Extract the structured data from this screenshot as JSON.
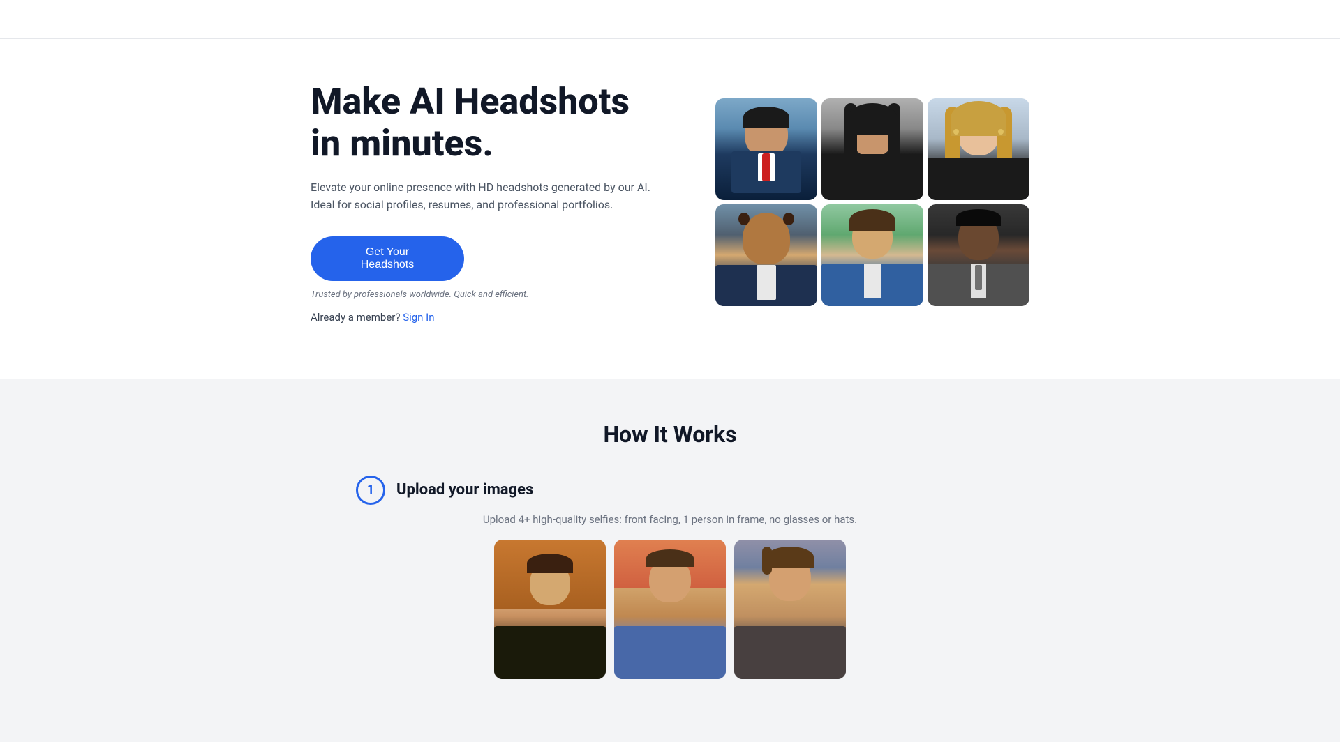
{
  "nav": {
    "brand": ""
  },
  "hero": {
    "title": "Make AI Headshots in minutes.",
    "subtitle": "Elevate your online presence with HD headshots generated by our AI. Ideal for social profiles, resumes, and professional portfolios.",
    "cta_button_label": "Get Your Headshots",
    "trusted_text": "Trusted by professionals worldwide. Quick and efficient.",
    "signin_prefix": "Already a member?",
    "signin_link": "Sign In"
  },
  "how_it_works": {
    "section_title": "How It Works",
    "step1": {
      "number": "1",
      "title": "Upload your images",
      "description": "Upload 4+ high-quality selfies: front facing, 1 person in frame, no glasses or hats."
    }
  },
  "photos": {
    "grid": [
      {
        "id": "person-1",
        "alt": "Man in blue suit with red tie"
      },
      {
        "id": "person-2",
        "alt": "Woman with dark hair in black top"
      },
      {
        "id": "person-3",
        "alt": "Woman with blonde hair"
      },
      {
        "id": "person-4",
        "alt": "Bald man in suit"
      },
      {
        "id": "person-5",
        "alt": "Young man in blue jacket"
      },
      {
        "id": "person-6",
        "alt": "Black man in grey suit"
      }
    ],
    "selfies": [
      {
        "id": "selfie-1",
        "alt": "Selfie of young man smiling"
      },
      {
        "id": "selfie-2",
        "alt": "Selfie of man outdoors"
      },
      {
        "id": "selfie-3",
        "alt": "Selfie of man in casual clothes"
      }
    ]
  }
}
